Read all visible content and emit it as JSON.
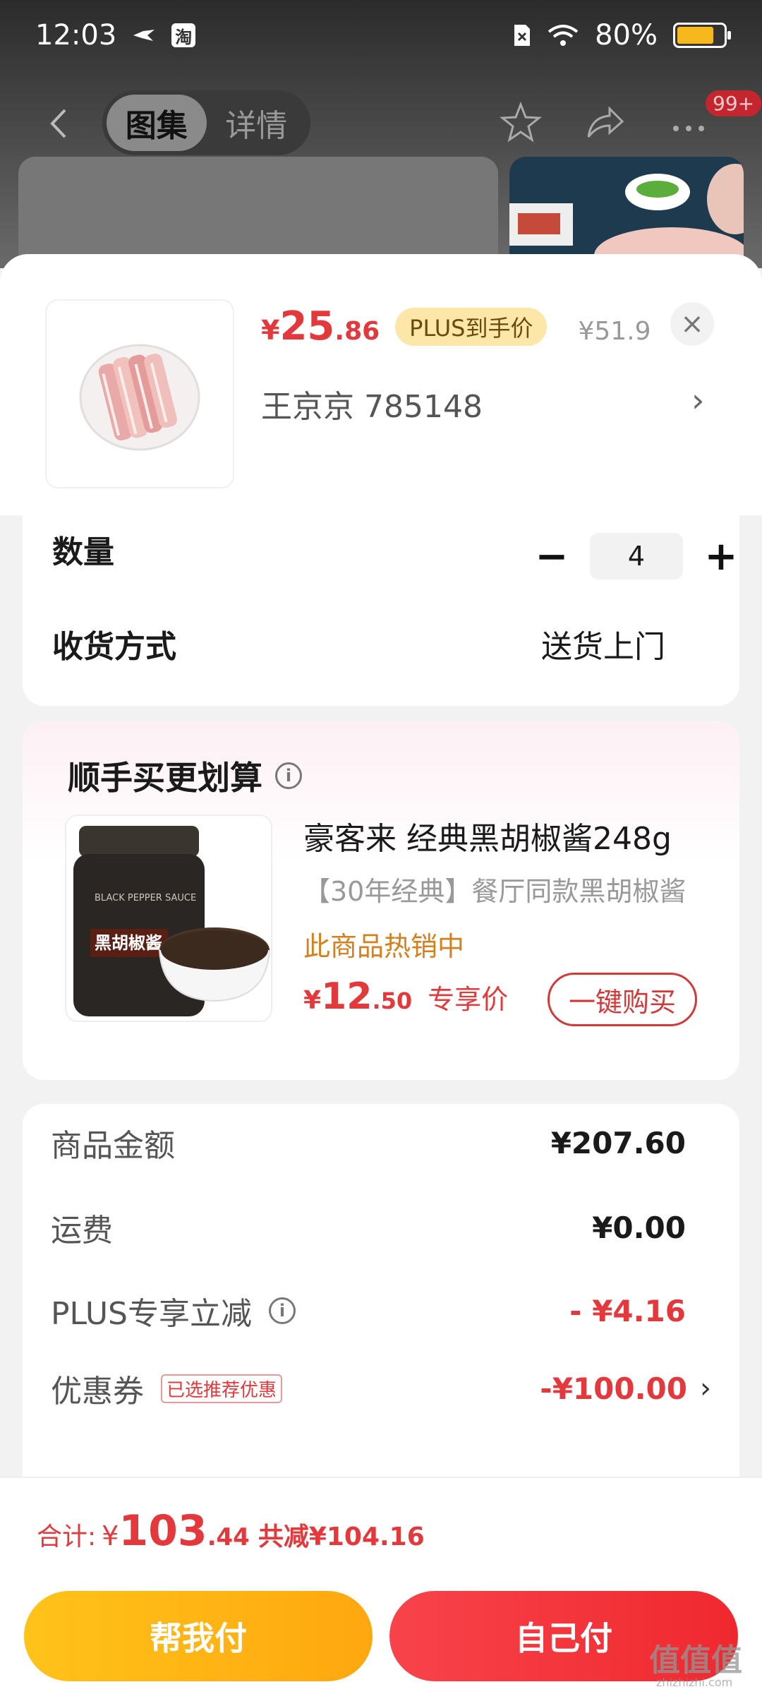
{
  "status_bar": {
    "time": "12:03",
    "app_badge": "淘",
    "battery": "80%"
  },
  "nav": {
    "tabs": [
      "图集",
      "详情"
    ],
    "badge": "99+"
  },
  "product": {
    "price_yen": "¥",
    "price_int": "25",
    "price_dec": ".86",
    "plus_tag": "PLUS到手价",
    "original_price": "¥51.9",
    "spec": "王京京  785148",
    "close": "×",
    "arrow": "›"
  },
  "quantity": {
    "label": "数量",
    "minus": "−",
    "value": "4",
    "plus": "+"
  },
  "delivery": {
    "label": "收货方式",
    "value": "送货上门"
  },
  "bundle": {
    "title": "顺手买更划算",
    "info": "i",
    "name": "豪客来 经典黑胡椒酱248g",
    "subtitle": "【30年经典】餐厅同款黑胡椒酱",
    "hot": "此商品热销中",
    "price_yen": "¥",
    "price_int": "12",
    "price_dec": ".50",
    "price_tag": "专享价",
    "buy_label": "一键购买",
    "jar_label": "黑胡椒酱",
    "jar_text": "BLACK PEPPER SAUCE"
  },
  "summary": {
    "goods_label": "商品金额",
    "goods_value": "¥207.60",
    "shipping_label": "运费",
    "shipping_value": "¥0.00",
    "plus_label": "PLUS专享立减",
    "plus_info": "i",
    "plus_value": "- ¥4.16",
    "coupon_label": "优惠券",
    "coupon_tag": "已选推荐优惠",
    "coupon_value": "-¥100.00",
    "coupon_arrow": "›"
  },
  "footer": {
    "total_label": "合计:",
    "total_yen": "¥",
    "total_int": "103",
    "total_dec": ".44",
    "save_text": "共减¥104.16",
    "help_pay": "帮我付",
    "self_pay": "自己付",
    "watermark": "值值值",
    "watermark_sub": "zhizhizhi.com"
  },
  "colors": {
    "accent": "#e4393c",
    "plus_tag_bg": "#fde7a8",
    "help_btn": "#ffb814",
    "self_btn": "#f3343b"
  }
}
